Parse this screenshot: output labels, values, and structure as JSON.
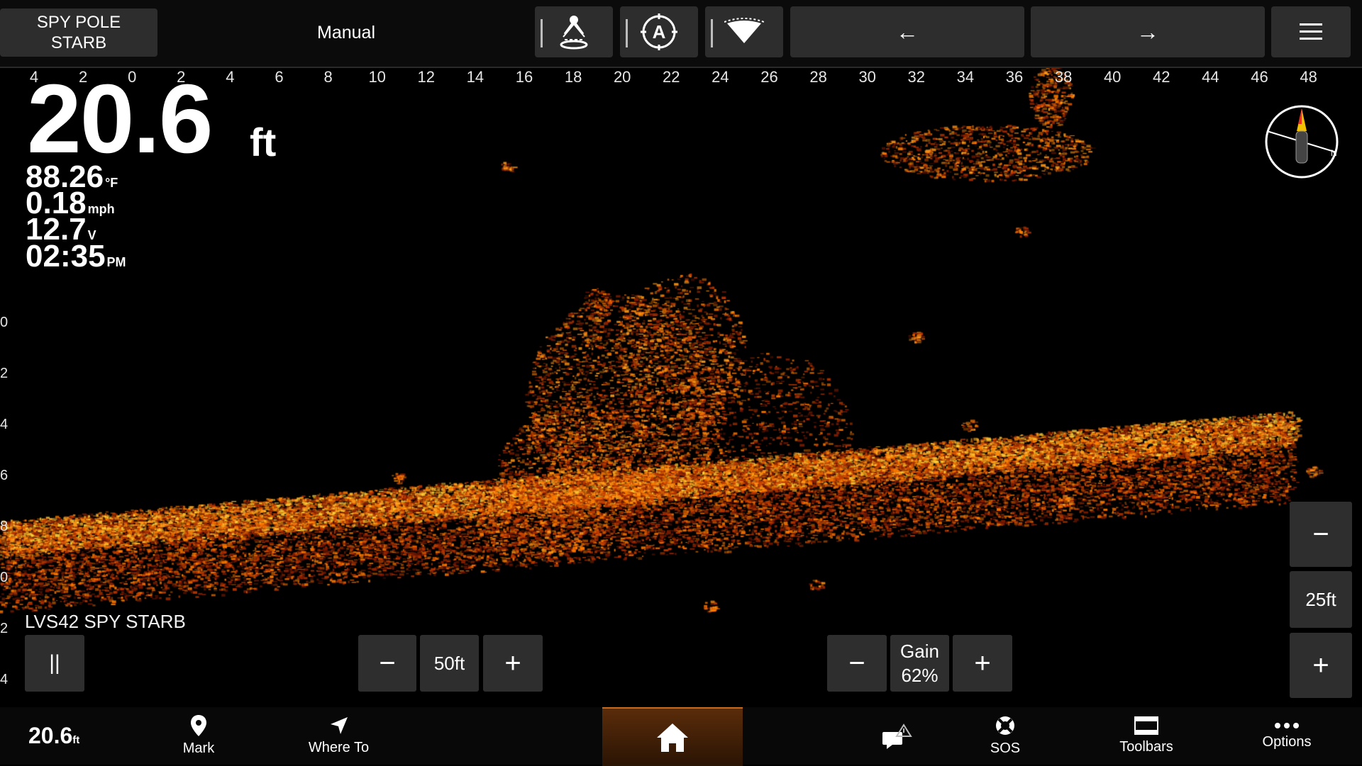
{
  "header": {
    "source_line1": "SPY POLE",
    "source_line2": "STARB",
    "mode": "Manual",
    "icons": [
      "perspective-forward-icon",
      "auto-mode-icon",
      "beam-cone-icon"
    ],
    "left_arrow": "←",
    "right_arrow": "→",
    "menu_icon": "hamburger-menu-icon"
  },
  "range_scale": [
    "4",
    "2",
    "0",
    "2",
    "4",
    "6",
    "8",
    "10",
    "12",
    "14",
    "16",
    "18",
    "20",
    "22",
    "24",
    "26",
    "28",
    "30",
    "32",
    "34",
    "36",
    "38",
    "40",
    "42",
    "44",
    "46",
    "48"
  ],
  "depth_scale": [
    "0",
    "2",
    "4",
    "6",
    "8",
    "0",
    "2",
    "4"
  ],
  "readouts": {
    "depth": "20.6",
    "depth_unit": "ft",
    "water_temp": "88.26",
    "water_temp_unit": "°F",
    "speed": "0.18",
    "speed_unit": "mph",
    "voltage": "12.7",
    "voltage_unit": "V",
    "time": "02:35",
    "time_suffix": "PM"
  },
  "transducer_label": "LVS42 SPY STARB",
  "controls": {
    "pause": "||",
    "range_minus": "−",
    "range_value": "50ft",
    "range_plus": "+",
    "gain_minus": "−",
    "gain_label": "Gain",
    "gain_value": "62%",
    "gain_plus": "+",
    "zoom_minus": "−",
    "zoom_value": "25ft",
    "zoom_plus": "+"
  },
  "bottom_nav": {
    "depth": "20.6",
    "depth_unit": "ft",
    "mark": "Mark",
    "where_to": "Where To",
    "sos": "SOS",
    "toolbars": "Toolbars",
    "options": "Options"
  },
  "colors": {
    "sonar_hot": "#ffd23a",
    "sonar_mid": "#ff7a00",
    "sonar_low": "#8a1e00",
    "button_bg": "#2e2e2e",
    "accent": "#c86a1e"
  }
}
